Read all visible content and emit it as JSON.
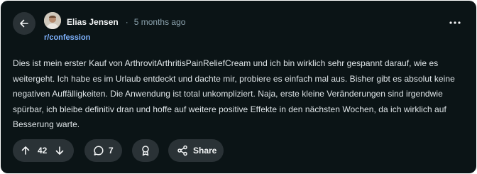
{
  "post": {
    "author": "Elias Jensen",
    "separator": "·",
    "time": "5 months ago",
    "subreddit": "r/confession",
    "body": "Dies ist mein erster Kauf von ArthrovitArthritisPainReliefCream und ich bin wirklich sehr gespannt darauf, wie es weitergeht. Ich habe es im Urlaub entdeckt und dachte mir, probiere es einfach mal aus. Bisher gibt es absolut keine negativen Auffälligkeiten. Die Anwendung ist total unkompliziert. Naja, erste kleine Veränderungen sind irgendwie spürbar, ich bleibe definitiv dran und hoffe auf weitere positive Effekte in den nächsten Wochen, da ich wirklich auf Besserung warte."
  },
  "actions": {
    "votes": "42",
    "comments": "7",
    "share_label": "Share"
  },
  "icons": {
    "back": "arrow-left-icon",
    "more": "more-horizontal-icon",
    "upvote": "arrow-up-icon",
    "downvote": "arrow-down-icon",
    "comment": "comment-bubble-icon",
    "award": "award-ribbon-icon",
    "share": "share-nodes-icon"
  },
  "colors": {
    "card_background": "#0b1416",
    "button_background": "#2a3236",
    "subreddit_link": "#7fb3ff",
    "muted_text": "#8ba2ad"
  }
}
